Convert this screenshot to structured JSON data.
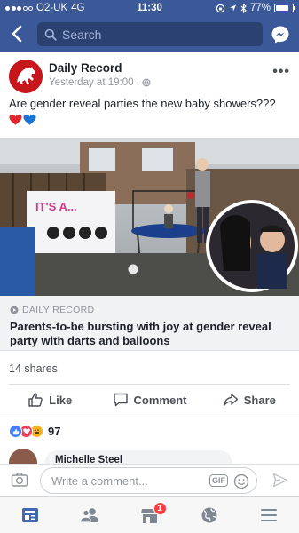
{
  "status_bar": {
    "carrier": "O2-UK",
    "network": "4G",
    "time": "11:30",
    "battery": "77%",
    "battery_level": 0.77
  },
  "navbar": {
    "back_icon": "chevron-left-icon",
    "search_placeholder": "Search",
    "messenger_icon": "messenger-icon"
  },
  "post": {
    "page_name": "Daily Record",
    "timestamp": "Yesterday at 19:00",
    "privacy_icon": "globe-icon",
    "text": "Are gender reveal parties the new baby showers???",
    "emoji": [
      "red-heart",
      "blue-heart"
    ],
    "media": {
      "banner_text": "IT'S A..."
    },
    "link": {
      "source": "DAILY RECORD",
      "title": "Parents-to-be bursting with joy at gender reveal party with darts and balloons"
    },
    "shares": "14 shares",
    "actions": {
      "like": "Like",
      "comment": "Comment",
      "share": "Share"
    },
    "reactions": {
      "types": [
        "like",
        "love",
        "haha"
      ],
      "count": "97"
    },
    "comment_preview": {
      "author": "Michelle Steel"
    }
  },
  "composer": {
    "placeholder": "Write a comment...",
    "gif_label": "GIF"
  },
  "tabbar": {
    "notifications_badge": "1",
    "tabs": [
      "news-feed-icon",
      "friends-icon",
      "marketplace-icon",
      "globe-notifications-icon",
      "menu-icon"
    ]
  },
  "colors": {
    "brand": "#3b5998",
    "like_blue": "#4080ff",
    "love_red": "#f33e58",
    "haha_yellow": "#f7b125",
    "badge_red": "#fa3e3e"
  }
}
